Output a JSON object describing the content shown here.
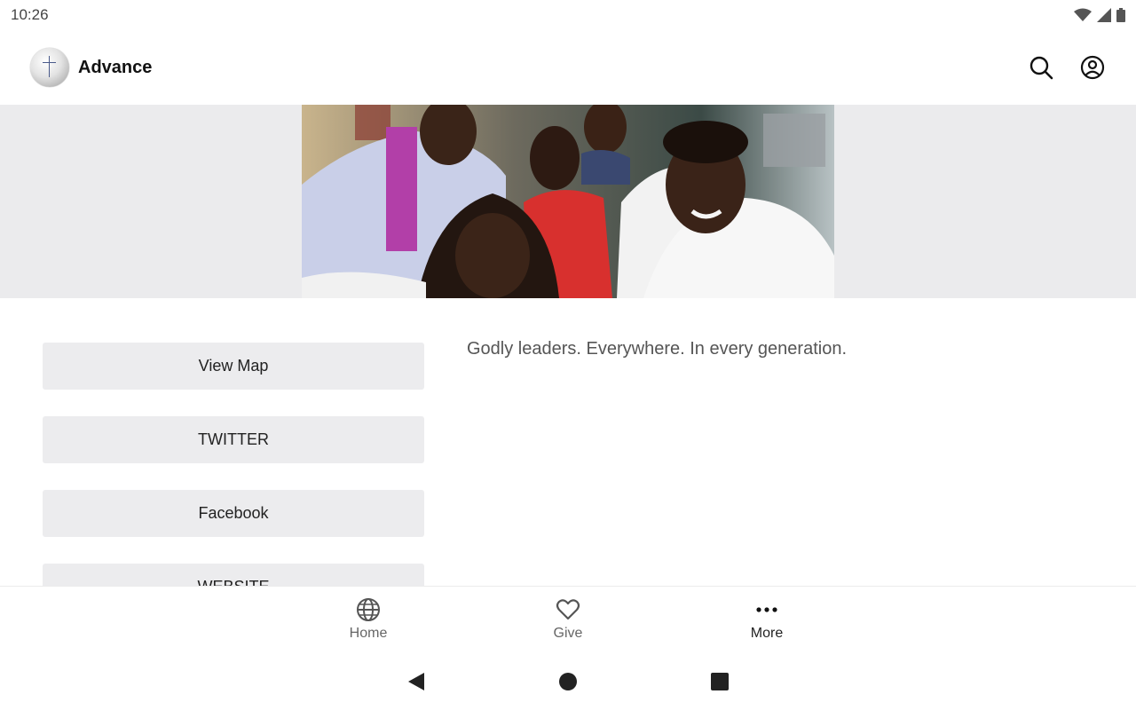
{
  "status": {
    "time": "10:26"
  },
  "header": {
    "title": "Advance"
  },
  "buttons": [
    {
      "label": "View Map"
    },
    {
      "label": "TWITTER"
    },
    {
      "label": "Facebook"
    },
    {
      "label": "WEBSITE"
    }
  ],
  "tagline": "Godly leaders. Everywhere. In every generation.",
  "nav": {
    "items": [
      {
        "label": "Home",
        "icon": "globe-icon"
      },
      {
        "label": "Give",
        "icon": "heart-icon"
      },
      {
        "label": "More",
        "icon": "more-icon"
      }
    ],
    "active": "More"
  },
  "colors": {
    "band": "#ebebed",
    "button_bg": "#ececee"
  }
}
